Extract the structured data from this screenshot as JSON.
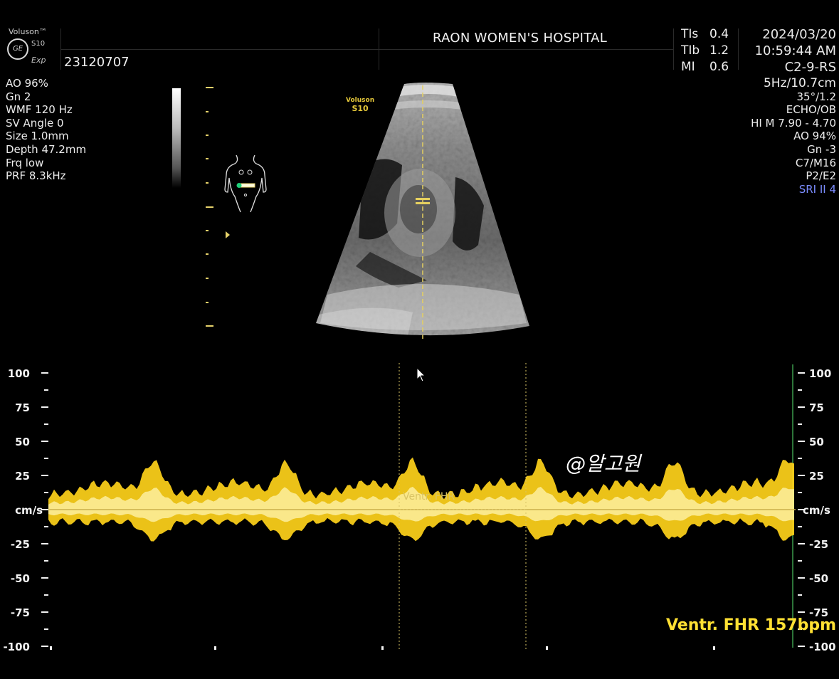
{
  "header": {
    "brand": "Voluson™",
    "model": "S10",
    "exp": "Exp",
    "ge_logo": "GE",
    "patient_id": "23120707",
    "hospital": "RAON WOMEN'S HOSPITAL",
    "indices": [
      {
        "name": "TIs",
        "value": "0.4"
      },
      {
        "name": "TIb",
        "value": "1.2"
      },
      {
        "name": "MI",
        "value": "0.6"
      }
    ],
    "date": "2024/03/20",
    "time": "10:59:44 AM",
    "probe": "C2-9-RS"
  },
  "left_params": [
    "AO 96%",
    "Gn  2",
    "WMF 120 Hz",
    "SV Angle  0",
    "Size  1.0mm",
    "Depth 47.2mm",
    "Frq low",
    "PRF  8.3kHz"
  ],
  "right_params": [
    "5Hz/10.7cm",
    "35°/1.2",
    "ECHO/OB",
    "HI M  7.90 - 4.70",
    "AO 94%",
    "Gn  -3",
    "C7/M16",
    "P2/E2"
  ],
  "right_params_highlight": "SRI II 4",
  "image_badge": {
    "line1": "Voluson",
    "line2": "S10"
  },
  "doppler": {
    "left_scale": [
      "100",
      "75",
      "50",
      "25",
      "cm/s",
      "-25",
      "-50",
      "-75",
      "-100"
    ],
    "right_scale": [
      "100",
      "75",
      "50",
      "25",
      "cm/s",
      "-25",
      "-50",
      "-75",
      "-100"
    ],
    "cursor_label": "Ventr. FHR",
    "readout": "Ventr. FHR 157bpm",
    "watermark": "@알고원"
  },
  "colors": {
    "doppler_fill": "#ffd21a",
    "doppler_core": "#fff4b0",
    "baseline": "#c9b04a",
    "text": "#ececec",
    "readout": "#ffe033",
    "sri": "#7b8cff"
  }
}
